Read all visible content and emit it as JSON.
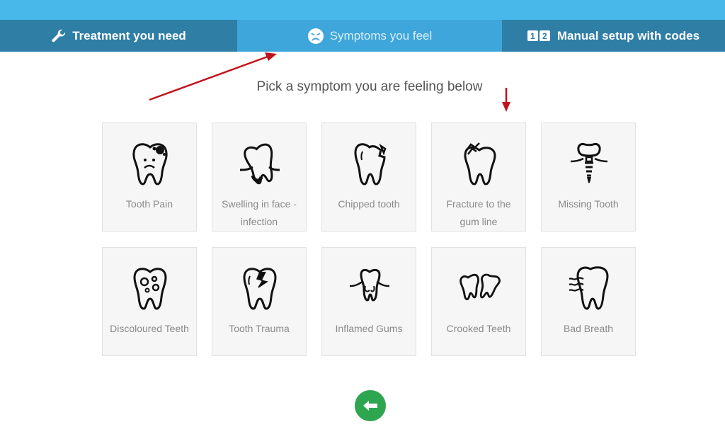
{
  "tabs": {
    "treatment": {
      "label": "Treatment you need",
      "icon": "wrench-icon"
    },
    "symptoms": {
      "label": "Symptoms you feel",
      "icon": "sad-face-icon"
    },
    "manual": {
      "label": "Manual setup with codes",
      "digits": [
        "1",
        "2"
      ]
    }
  },
  "headline": "Pick a symptom you are feeling below",
  "symptoms": [
    {
      "label": "Tooth Pain",
      "icon": "tooth-pain-icon"
    },
    {
      "label": "Swelling in face - infection",
      "icon": "tooth-swelling-icon"
    },
    {
      "label": "Chipped tooth",
      "icon": "chipped-tooth-icon"
    },
    {
      "label": "Fracture to the gum line",
      "icon": "fractured-tooth-icon"
    },
    {
      "label": "Missing Tooth",
      "icon": "dental-implant-icon"
    },
    {
      "label": "Discoloured Teeth",
      "icon": "discoloured-tooth-icon"
    },
    {
      "label": "Tooth Trauma",
      "icon": "cracked-tooth-icon"
    },
    {
      "label": "Inflamed Gums",
      "icon": "inflamed-gums-icon"
    },
    {
      "label": "Crooked Teeth",
      "icon": "crooked-teeth-icon"
    },
    {
      "label": "Bad Breath",
      "icon": "bad-breath-icon"
    }
  ],
  "back_button": {
    "icon": "arrow-left-icon"
  },
  "colors": {
    "topbar": "#48b7ea",
    "tab_dark": "#2f7ea6",
    "tab_active": "#3ea6da",
    "card_bg": "#f6f6f6",
    "back_button": "#2ea54f",
    "annotation_arrow": "#c0121b"
  }
}
